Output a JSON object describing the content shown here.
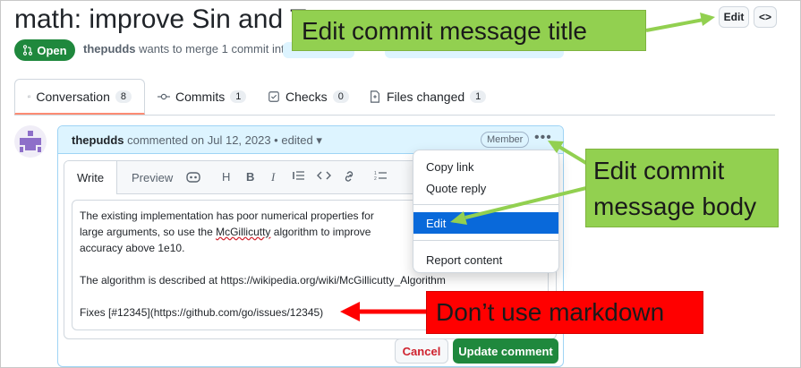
{
  "page": {
    "title": "math: improve Sin and Ta",
    "edit_label": "Edit",
    "code_label": "<>"
  },
  "pr": {
    "state": "Open",
    "author": "thepudds",
    "merge_text": "wants to merge 1 commit into"
  },
  "tabs": [
    {
      "label": "Conversation",
      "count": "8"
    },
    {
      "label": "Commits",
      "count": "1"
    },
    {
      "label": "Checks",
      "count": "0"
    },
    {
      "label": "Files changed",
      "count": "1"
    }
  ],
  "comment": {
    "author": "thepudds",
    "meta": "commented on Jul 12, 2023 • edited",
    "badge": "Member",
    "editor_tabs": {
      "write": "Write",
      "preview": "Preview"
    },
    "toolbar": [
      "H",
      "B",
      "I"
    ],
    "body": {
      "line1": "The existing implementation has poor numerical properties for",
      "line2a": "large arguments, so use the ",
      "line2b": "McGillicutty",
      "line2c": " algorithm to improve",
      "line3": "accuracy above 1e10.",
      "line4": "The algorithm is described at https://wikipedia.org/wiki/McGillicutty_Algorithm",
      "line5": "Fixes [#12345](https://github.com/go/issues/12345)"
    },
    "cancel_label": "Cancel",
    "update_label": "Update comment"
  },
  "menu": {
    "items": [
      "Copy link",
      "Quote reply",
      "Edit",
      "Report content"
    ],
    "selected": "Edit"
  },
  "annotations": {
    "title_callout": "Edit commit message title",
    "body_callout_line1": "Edit commit",
    "body_callout_line2": "message body",
    "markdown_callout": "Don’t use markdown"
  },
  "colors": {
    "green": "#1f883d",
    "callout_green": "#92d050",
    "callout_red": "#ff0000",
    "menu_selected": "#0969da"
  }
}
